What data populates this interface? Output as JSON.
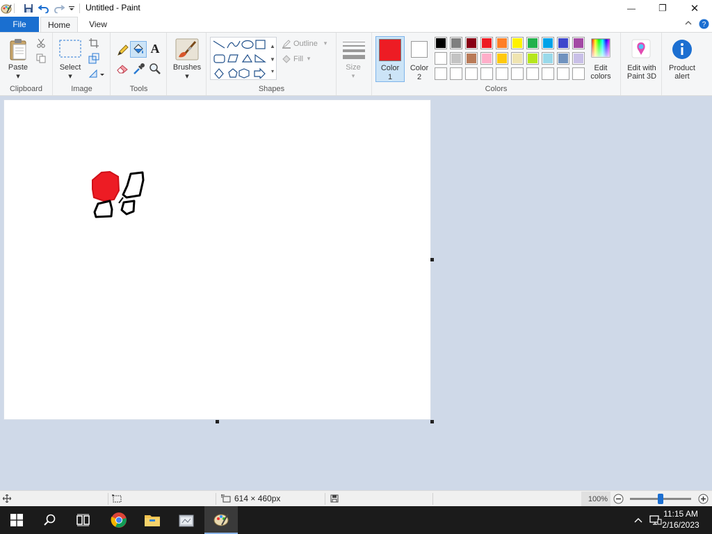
{
  "window": {
    "title": "Untitled - Paint",
    "minimize_glyph": "—",
    "maximize_glyph": "❐",
    "close_glyph": "✕"
  },
  "tabs": {
    "file": "File",
    "home": "Home",
    "view": "View"
  },
  "ribbon": {
    "clipboard": {
      "label": "Clipboard",
      "paste": "Paste"
    },
    "image": {
      "label": "Image",
      "select": "Select"
    },
    "tools": {
      "label": "Tools",
      "text_glyph": "A"
    },
    "brushes": {
      "label": "Brushes"
    },
    "shapes": {
      "label": "Shapes",
      "outline": "Outline",
      "fill": "Fill"
    },
    "size": {
      "label": "Size"
    },
    "color1": {
      "label_line1": "Color",
      "label_line2": "1",
      "color": "#ed1c24"
    },
    "color2": {
      "label_line1": "Color",
      "label_line2": "2",
      "color": "#ffffff"
    },
    "colors": {
      "label": "Colors"
    },
    "edit_colors": {
      "line1": "Edit",
      "line2": "colors"
    },
    "paint3d": {
      "line1": "Edit with",
      "line2": "Paint 3D"
    },
    "product_alert": {
      "line1": "Product",
      "line2": "alert"
    }
  },
  "palette": {
    "row1": [
      "#000000",
      "#7f7f7f",
      "#880015",
      "#ed1c24",
      "#ff7f27",
      "#fff200",
      "#22b14c",
      "#00a2e8",
      "#3f48cc",
      "#a349a4"
    ],
    "row2": [
      "#ffffff",
      "#c3c3c3",
      "#b97a57",
      "#ffaec9",
      "#ffc90e",
      "#efe4b0",
      "#b5e61d",
      "#99d9ea",
      "#7092be",
      "#c8bfe7"
    ],
    "row3": [
      "#ffffff",
      "#ffffff",
      "#ffffff",
      "#ffffff",
      "#ffffff",
      "#ffffff",
      "#ffffff",
      "#ffffff",
      "#ffffff",
      "#ffffff"
    ]
  },
  "status": {
    "canvas_size": "614 × 460px",
    "zoom": "100%"
  },
  "taskbar": {
    "time": "11:15 AM",
    "date": "2/16/2023"
  }
}
